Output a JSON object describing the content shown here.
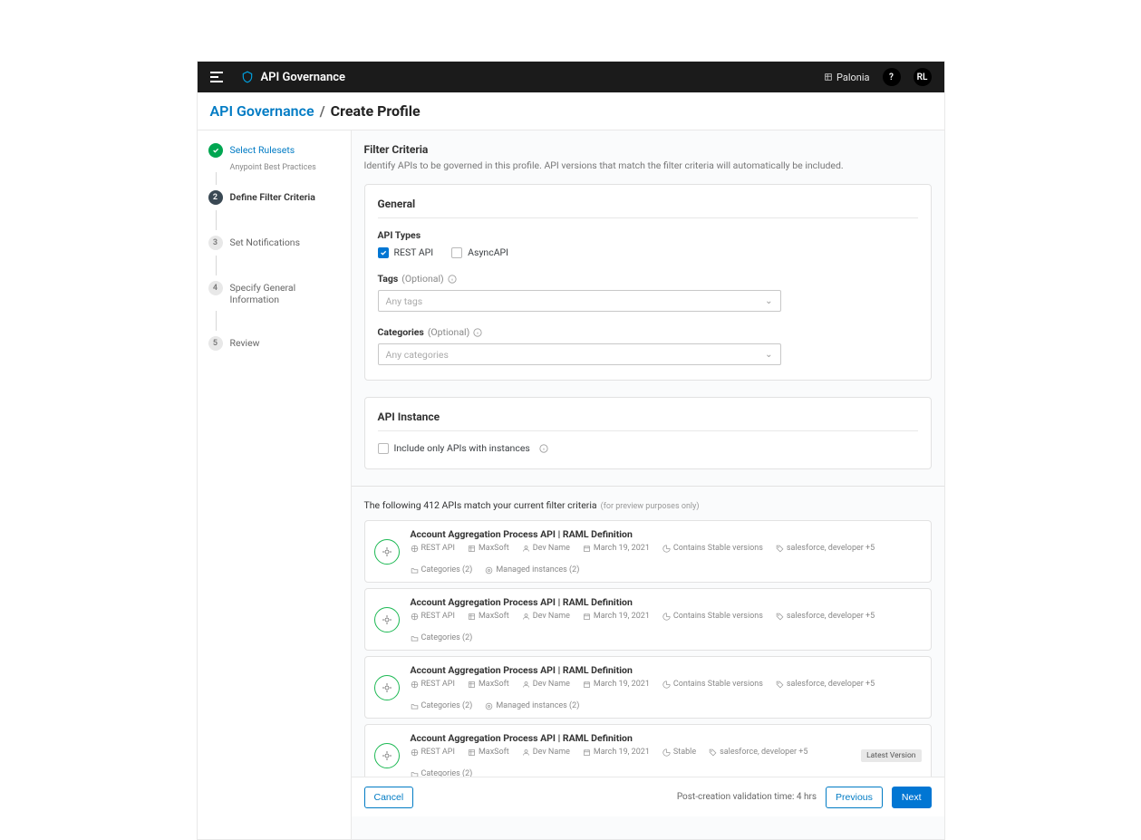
{
  "topbar": {
    "title": "API Governance",
    "org": "Palonia",
    "help": "?",
    "avatar": "RL"
  },
  "breadcrumb": {
    "section": "API Governance",
    "page": "Create Profile"
  },
  "steps": [
    {
      "label": "Select Rulesets",
      "sub": "Anypoint Best Practices"
    },
    {
      "label": "Define Filter Criteria"
    },
    {
      "label": "Set Notifications"
    },
    {
      "label": "Specify General Information"
    },
    {
      "label": "Review"
    }
  ],
  "filter": {
    "title": "Filter Criteria",
    "desc": "Identify APIs to be governed in this profile. API versions that match the filter criteria will automatically be included."
  },
  "general": {
    "heading": "General",
    "apiTypesLabel": "API Types",
    "restLabel": "REST API",
    "asyncLabel": "AsyncAPI",
    "tagsLabel": "Tags",
    "optional": "(Optional)",
    "tagsPlaceholder": "Any tags",
    "categoriesLabel": "Categories",
    "categoriesPlaceholder": "Any categories"
  },
  "instance": {
    "heading": "API Instance",
    "checkboxLabel": "Include only APIs with instances"
  },
  "results": {
    "text": "The following 412 APIs match your current filter criteria",
    "hint": "(for preview purposes only)"
  },
  "apis": [
    {
      "name": "Account Aggregation Process API | RAML Definition",
      "type": "REST API",
      "org": "MaxSoft",
      "dev": "Dev Name",
      "date": "March 19, 2021",
      "status": "Contains Stable versions",
      "tags": "salesforce, developer +5",
      "cats": "Categories (2)",
      "managed": "Managed instances (2)",
      "latest": ""
    },
    {
      "name": "Account Aggregation Process API | RAML Definition",
      "type": "REST API",
      "org": "MaxSoft",
      "dev": "Dev Name",
      "date": "March 19, 2021",
      "status": "Contains Stable versions",
      "tags": "salesforce, developer +5",
      "cats": "Categories (2)",
      "managed": "",
      "latest": ""
    },
    {
      "name": "Account Aggregation Process API | RAML Definition",
      "type": "REST API",
      "org": "MaxSoft",
      "dev": "Dev Name",
      "date": "March 19, 2021",
      "status": "Contains Stable versions",
      "tags": "salesforce, developer +5",
      "cats": "Categories (2)",
      "managed": "Managed instances (2)",
      "latest": ""
    },
    {
      "name": "Account Aggregation Process API | RAML Definition",
      "type": "REST API",
      "org": "MaxSoft",
      "dev": "Dev Name",
      "date": "March 19, 2021",
      "status": "Stable",
      "tags": "salesforce, developer +5",
      "cats": "Categories (2)",
      "managed": "",
      "latest": "Latest Version"
    }
  ],
  "footer": {
    "cancel": "Cancel",
    "postText": "Post-creation validation time: 4 hrs",
    "previous": "Previous",
    "next": "Next"
  }
}
